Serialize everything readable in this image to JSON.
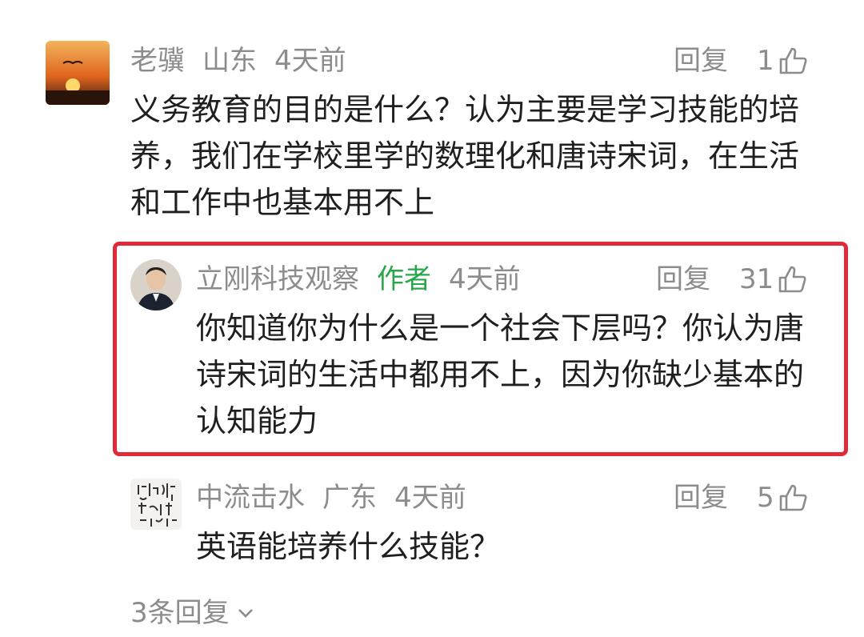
{
  "comments": [
    {
      "user": "老骥",
      "location": "山东",
      "time": "4天前",
      "reply_label": "回复",
      "likes": "1",
      "text": "义务教育的目的是什么？认为主要是学习技能的培养，我们在学校里学的数理化和唐诗宋词，在生活和工作中也基本用不上"
    },
    {
      "user": "立刚科技观察",
      "author_badge": "作者",
      "time": "4天前",
      "reply_label": "回复",
      "likes": "31",
      "text": "你知道你为什么是一个社会下层吗？你认为唐诗宋词的生活中都用不上，因为你缺少基本的认知能力"
    },
    {
      "user": "中流击水",
      "location": "广东",
      "time": "4天前",
      "reply_label": "回复",
      "likes": "5",
      "text": "英语能培养什么技能？"
    }
  ],
  "more_replies": "3条回复",
  "colors": {
    "highlight_border": "#e02a37",
    "author_badge": "#27a74a",
    "meta_gray": "#8c8c8c"
  },
  "icons": {
    "like": "thumbs-up-icon",
    "expand": "chevron-down-icon"
  }
}
